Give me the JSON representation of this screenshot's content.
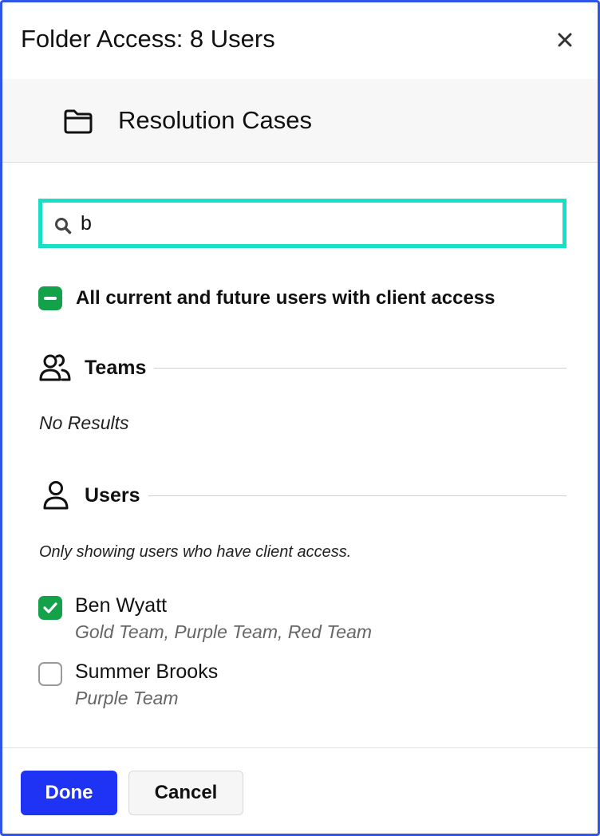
{
  "dialog": {
    "title": "Folder Access: 8 Users",
    "close_icon": "close-icon"
  },
  "folder": {
    "icon": "folder-icon",
    "name": "Resolution Cases"
  },
  "search": {
    "icon": "search-icon",
    "value": "b"
  },
  "all_users": {
    "label": "All current and future users with client access",
    "state": "indeterminate",
    "color": "#13a24a"
  },
  "teams_section": {
    "icon": "users-group-icon",
    "title": "Teams",
    "empty_text": "No Results"
  },
  "users_section": {
    "icon": "user-icon",
    "title": "Users",
    "note": "Only showing users who have client access.",
    "items": [
      {
        "name": "Ben Wyatt",
        "teams": "Gold Team, Purple Team, Red Team",
        "checked": true
      },
      {
        "name": "Summer Brooks",
        "teams": "Purple Team",
        "checked": false
      }
    ]
  },
  "footer": {
    "done_label": "Done",
    "cancel_label": "Cancel"
  },
  "colors": {
    "accent": "#1f33f5",
    "frame": "#2f55e6",
    "search_focus": "#19e0c4",
    "check_green": "#13a24a"
  }
}
